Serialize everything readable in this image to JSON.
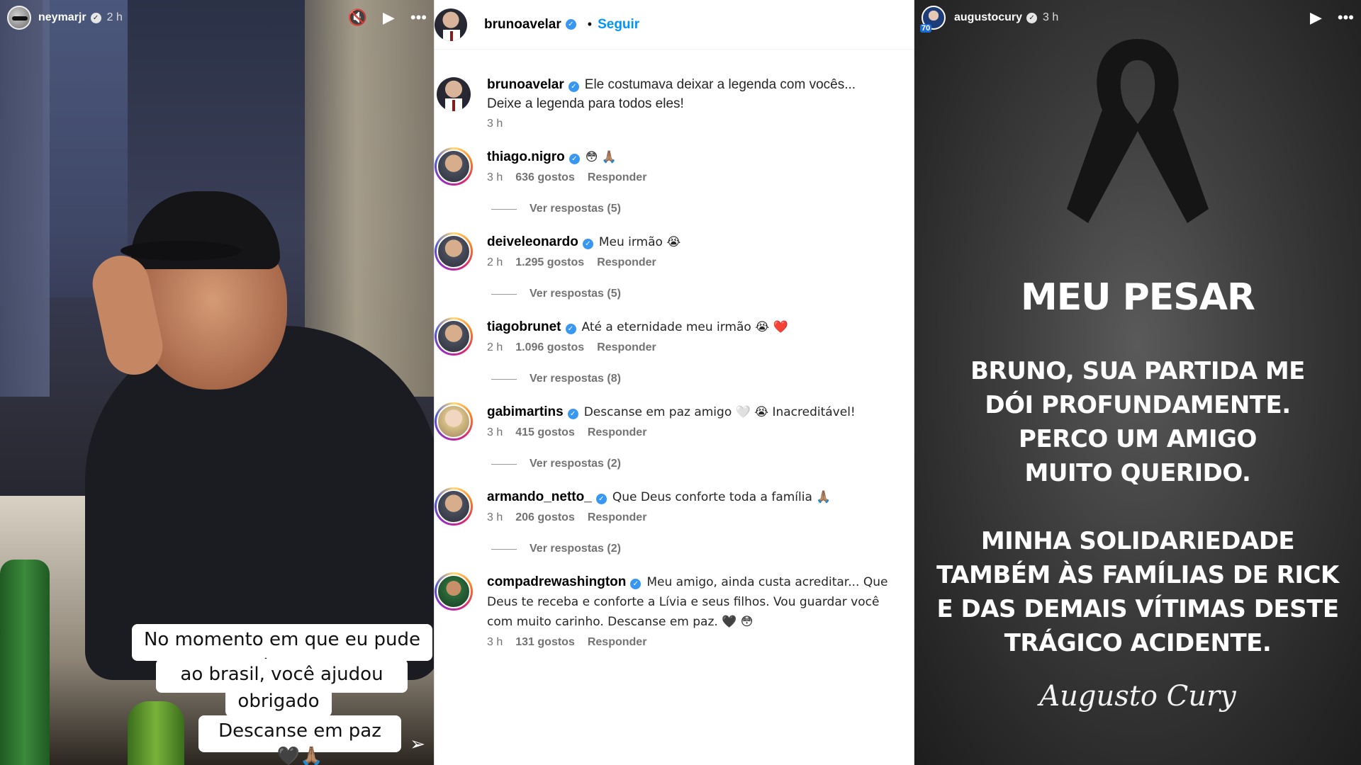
{
  "left_story": {
    "username": "neymarjr",
    "time": "2 h",
    "caption_lines": [
      "No momento em que eu pude retornar",
      "ao brasil, você ajudou demais...",
      "obrigado 🙏🏽",
      "Descanse em paz 🖤🙏🏽"
    ],
    "icons": [
      "mute-icon",
      "play-icon",
      "more-icon",
      "heart-icon",
      "send-icon"
    ]
  },
  "post": {
    "author": "brunoavelar",
    "follow_label": "Seguir",
    "caption": "Ele costumava deixar a legenda com vocês... Deixe a legenda para todos eles!",
    "caption_time": "3 h",
    "reply_label": "Responder",
    "comments": [
      {
        "user": "thiago.nigro",
        "text": "😳 🙏🏽",
        "time": "3 h",
        "likes": "636 gostos",
        "replies": "Ver respostas (5)"
      },
      {
        "user": "deiveleonardo",
        "text": "Meu irmão 😭",
        "time": "2 h",
        "likes": "1.295 gostos",
        "replies": "Ver respostas (5)"
      },
      {
        "user": "tiagobrunet",
        "text": "Até a eternidade meu irmão 😭 ❤️",
        "time": "2 h",
        "likes": "1.096 gostos",
        "replies": "Ver respostas (8)"
      },
      {
        "user": "gabimartins",
        "text": "Descanse em paz amigo 🤍 😭 Inacreditável!",
        "time": "3 h",
        "likes": "415 gostos",
        "replies": "Ver respostas (2)"
      },
      {
        "user": "armando_netto_",
        "text": "Que Deus conforte toda a família 🙏🏽",
        "time": "3 h",
        "likes": "206 gostos",
        "replies": "Ver respostas (2)"
      },
      {
        "user": "compadrewashington",
        "text": "Meu amigo, ainda custa acreditar... Que Deus te receba e conforte a Lívia e seus filhos. Vou guardar você com muito carinho. Descanse em paz. 🖤 😳",
        "time": "3 h",
        "likes": "131 gostos",
        "replies": ""
      }
    ]
  },
  "right_story": {
    "username": "augustocury",
    "time": "3 h",
    "avatar_badge": "70",
    "title": "MEU PESAR",
    "paragraph1": [
      "BRUNO, SUA PARTIDA ME",
      "DÓI PROFUNDAMENTE.",
      "PERCO UM AMIGO",
      "MUITO QUERIDO."
    ],
    "paragraph2": [
      "MINHA SOLIDARIEDADE",
      "TAMBÉM ÀS FAMÍLIAS DE RICK",
      "E DAS DEMAIS VÍTIMAS DESTE",
      "TRÁGICO ACIDENTE."
    ],
    "signature": "Augusto Cury"
  }
}
